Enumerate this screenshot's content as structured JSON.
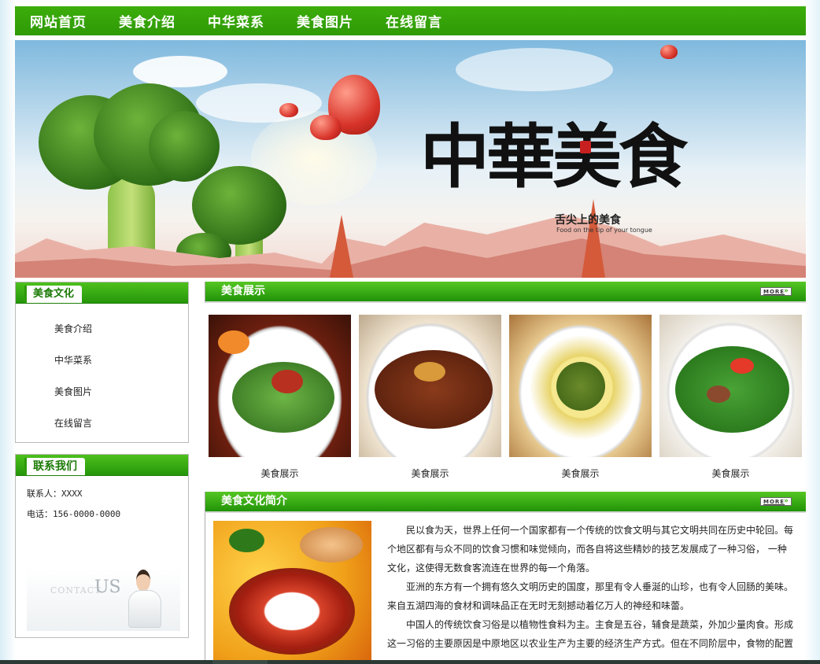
{
  "nav": {
    "items": [
      "网站首页",
      "美食介绍",
      "中华菜系",
      "美食图片",
      "在线留言"
    ]
  },
  "banner": {
    "title": "中華美食",
    "subtitle_cn": "舌尖上的美食",
    "subtitle_en": "Food on the tip of your tongue"
  },
  "sidebar": {
    "culture_title": "美食文化",
    "menu": [
      "美食介绍",
      "中华菜系",
      "美食图片",
      "在线留言"
    ],
    "contact_title": "联系我们",
    "contact_person": "联系人：XXXX",
    "contact_phone": "电话：156-0000-0000",
    "contact_image_text_small": "CONTACT",
    "contact_image_text_large": "US"
  },
  "showcase": {
    "title": "美食展示",
    "more_label": "MORE",
    "items": [
      {
        "caption": "美食展示"
      },
      {
        "caption": "美食展示"
      },
      {
        "caption": "美食展示"
      },
      {
        "caption": "美食展示"
      }
    ]
  },
  "intro": {
    "title": "美食文化简介",
    "more_label": "MORE",
    "paragraphs": [
      "民以食为天，世界上任何一个国家都有一个传统的饮食文明与其它文明共同在历史中轮回。每个地区都有与众不同的饮食习惯和味觉倾向，而各自将这些精妙的技艺发展成了一种习俗， 一种文化，这使得无数食客流连在世界的每一个角落。",
      "亚洲的东方有一个拥有悠久文明历史的国度，那里有令人垂涎的山珍，也有令人回肠的美味。来自五湖四海的食材和调味品正在无时无刻撼动着亿万人的神经和味蕾。",
      "中国人的传统饮食习俗是以植物性食料为主。主食是五谷，辅食是蔬菜，外加少量肉食。形成这一习俗的主要原因是中原地区以农业生产为主要的经济生产方式。但在不同阶层中，食物的配置"
    ]
  },
  "colors": {
    "nav_green": "#3aa80a",
    "header_green": "#25960a",
    "tab_text_green": "#1b7a05"
  }
}
